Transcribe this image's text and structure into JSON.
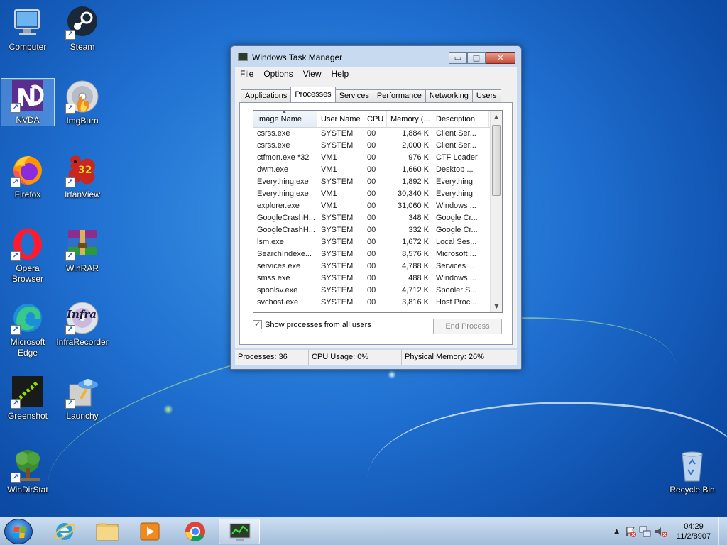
{
  "desktop": {
    "icons": [
      {
        "label": "Computer"
      },
      {
        "label": "Steam"
      },
      {
        "label": "NVDA"
      },
      {
        "label": "ImgBurn"
      },
      {
        "label": "Firefox"
      },
      {
        "label": "IrfanView"
      },
      {
        "label": "Opera Browser"
      },
      {
        "label": "WinRAR"
      },
      {
        "label": "Microsoft Edge"
      },
      {
        "label": "InfraRecorder"
      },
      {
        "label": "Greenshot"
      },
      {
        "label": "Launchy"
      },
      {
        "label": "WinDirStat"
      },
      {
        "label": "Recycle Bin"
      }
    ],
    "irfanview_badge": "32",
    "nvda_letters": "N",
    "infra_text": "Infra"
  },
  "taskmanager": {
    "title": "Windows Task Manager",
    "menu": [
      "File",
      "Options",
      "View",
      "Help"
    ],
    "tabs": [
      "Applications",
      "Processes",
      "Services",
      "Performance",
      "Networking",
      "Users"
    ],
    "active_tab": "Processes",
    "columns": [
      "Image Name",
      "User Name",
      "CPU",
      "Memory (...",
      "Description"
    ],
    "rows": [
      [
        "csrss.exe",
        "SYSTEM",
        "00",
        "1,884 K",
        "Client Ser..."
      ],
      [
        "csrss.exe",
        "SYSTEM",
        "00",
        "2,000 K",
        "Client Ser..."
      ],
      [
        "ctfmon.exe *32",
        "VM1",
        "00",
        "976 K",
        "CTF Loader"
      ],
      [
        "dwm.exe",
        "VM1",
        "00",
        "1,660 K",
        "Desktop ..."
      ],
      [
        "Everything.exe",
        "SYSTEM",
        "00",
        "1,892 K",
        "Everything"
      ],
      [
        "Everything.exe",
        "VM1",
        "00",
        "30,340 K",
        "Everything"
      ],
      [
        "explorer.exe",
        "VM1",
        "00",
        "31,060 K",
        "Windows ..."
      ],
      [
        "GoogleCrashH...",
        "SYSTEM",
        "00",
        "348 K",
        "Google Cr..."
      ],
      [
        "GoogleCrashH...",
        "SYSTEM",
        "00",
        "332 K",
        "Google Cr..."
      ],
      [
        "lsm.exe",
        "SYSTEM",
        "00",
        "1,672 K",
        "Local Ses..."
      ],
      [
        "SearchIndexe...",
        "SYSTEM",
        "00",
        "8,576 K",
        "Microsoft ..."
      ],
      [
        "services.exe",
        "SYSTEM",
        "00",
        "4,788 K",
        "Services ..."
      ],
      [
        "smss.exe",
        "SYSTEM",
        "00",
        "488 K",
        "Windows ..."
      ],
      [
        "spoolsv.exe",
        "SYSTEM",
        "00",
        "4,712 K",
        "Spooler S..."
      ],
      [
        "svchost.exe",
        "SYSTEM",
        "00",
        "3,816 K",
        "Host Proc..."
      ]
    ],
    "show_all_label": "Show processes from all users",
    "show_all_checked": "✓",
    "end_process_label": "End Process",
    "status": {
      "processes": "Processes: 36",
      "cpu": "CPU Usage: 0%",
      "memory": "Physical Memory: 26%"
    },
    "window_buttons": {
      "minimize": "▭",
      "maximize": "□",
      "close": "✕"
    }
  },
  "taskbar": {
    "pinned": [
      "Internet Explorer",
      "Windows Explorer",
      "Windows Media Player",
      "Google Chrome",
      "Task Manager"
    ],
    "clock_time": "04:29",
    "clock_date": "11/2/8907",
    "tray_arrow": "▲"
  }
}
